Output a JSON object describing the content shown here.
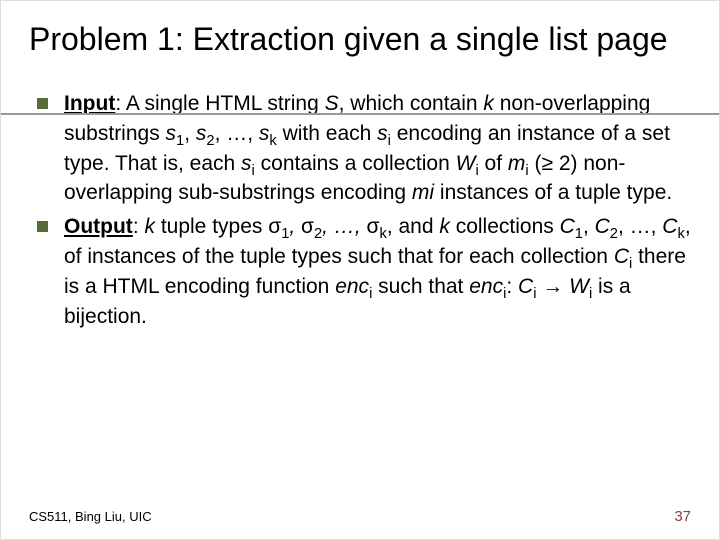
{
  "title": "Problem 1: Extraction given a single list page",
  "bullets": [
    {
      "label": "Input",
      "rest1": ": A single HTML string ",
      "S": "S",
      "rest2": ", which contain ",
      "k1": "k",
      "rest3": " non-overlapping substrings ",
      "s": "s",
      "rest4": " with each ",
      "rest5": " encoding an instance of a set type. That is, each ",
      "rest6": " contains a collection ",
      "W": "W",
      "rest7": " of ",
      "m": "m",
      "geq": " (≥ 2) non-overlapping sub-substrings encoding ",
      "mi": "mi",
      "rest8": " instances of a tuple type.",
      "comma_ellipsis": ", …, ",
      "comma": ", ",
      "one": "1",
      "two": "2",
      "kk": "k",
      "ii": "i"
    },
    {
      "label": "Output",
      "rest1": ": ",
      "k1": "k",
      "rest2": " tuple types ",
      "sigma": "σ",
      "rest3": ", and ",
      "k2": "k",
      "rest4": " collections ",
      "C": "C",
      "rest5": ", of instances of the tuple types such that for each collection ",
      "rest6": " there is a HTML encoding function ",
      "enc": "enc",
      "rest7": " such that ",
      "colon": ": ",
      "arrow": " → ",
      "W": "W",
      "rest8": " is a bijection.",
      "comma_ellipsis_it": ", …, ",
      "comma_ellipsis": ", …, ",
      "comma": ", ",
      "one": "1",
      "two": "2",
      "kk": "k",
      "ii": "i"
    }
  ],
  "footer": {
    "left": "CS511, Bing Liu, UIC",
    "right": "37"
  }
}
